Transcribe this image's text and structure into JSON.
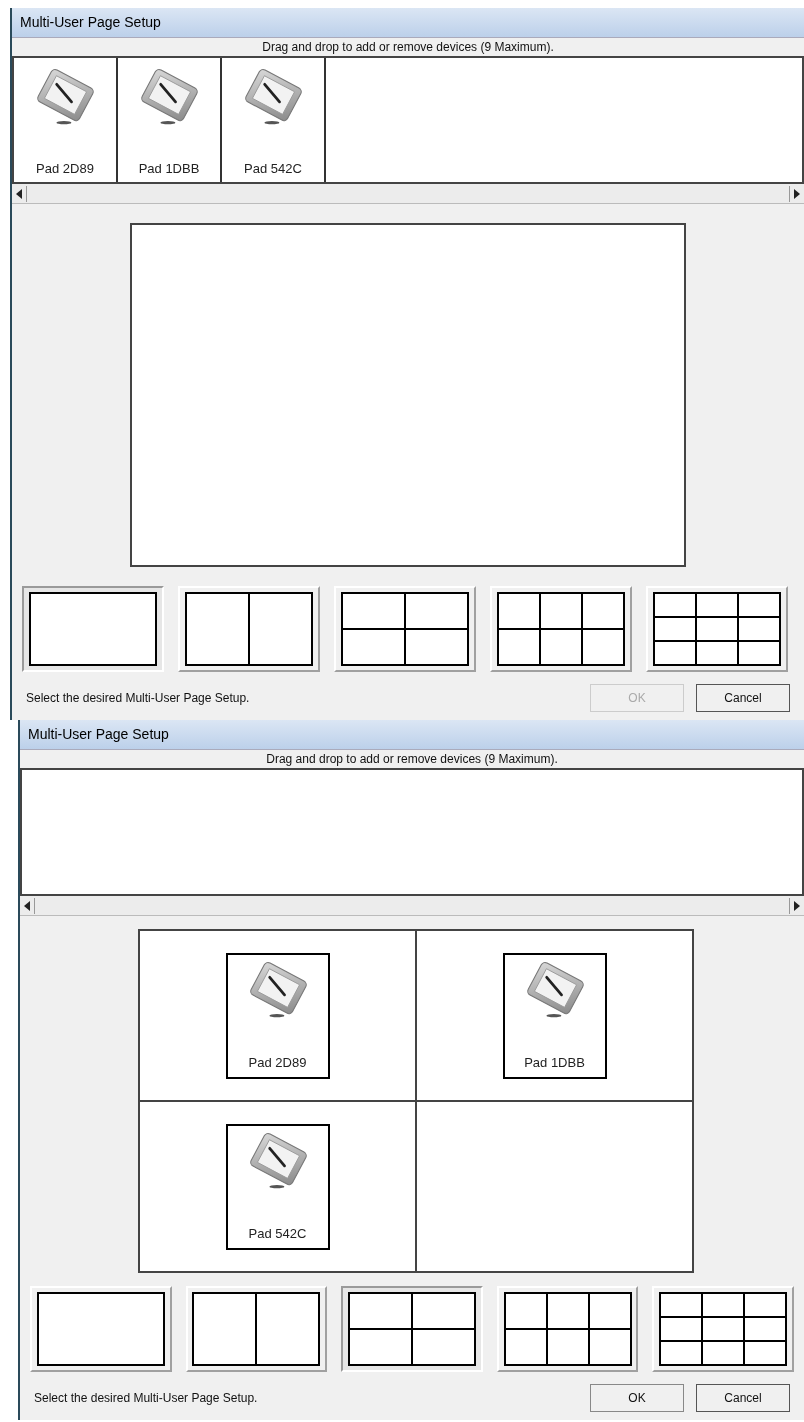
{
  "dialogs": [
    {
      "title": "Multi-User Page Setup",
      "instruction": "Drag and drop to add or remove devices (9 Maximum).",
      "tray_devices": [
        "Pad 2D89",
        "Pad 1DBB",
        "Pad 542C"
      ],
      "layouts": [
        {
          "kind": "single",
          "selected": true
        },
        {
          "kind": "two",
          "selected": false
        },
        {
          "kind": "four",
          "selected": false
        },
        {
          "kind": "six",
          "selected": false
        },
        {
          "kind": "nine",
          "selected": false
        }
      ],
      "hint": "Select the desired Multi-User Page Setup.",
      "ok": {
        "label": "OK",
        "disabled": true
      },
      "cancel": {
        "label": "Cancel"
      }
    },
    {
      "title": "Multi-User Page Setup",
      "instruction": "Drag and drop to add or remove devices (9 Maximum).",
      "preview_devices": [
        "Pad 2D89",
        "Pad 1DBB",
        "Pad 542C"
      ],
      "layouts": [
        {
          "kind": "single",
          "selected": false
        },
        {
          "kind": "two",
          "selected": false
        },
        {
          "kind": "four",
          "selected": true
        },
        {
          "kind": "six",
          "selected": false
        },
        {
          "kind": "nine",
          "selected": false
        }
      ],
      "hint": "Select the desired Multi-User Page Setup.",
      "ok": {
        "label": "OK",
        "disabled": false
      },
      "cancel": {
        "label": "Cancel"
      }
    }
  ]
}
